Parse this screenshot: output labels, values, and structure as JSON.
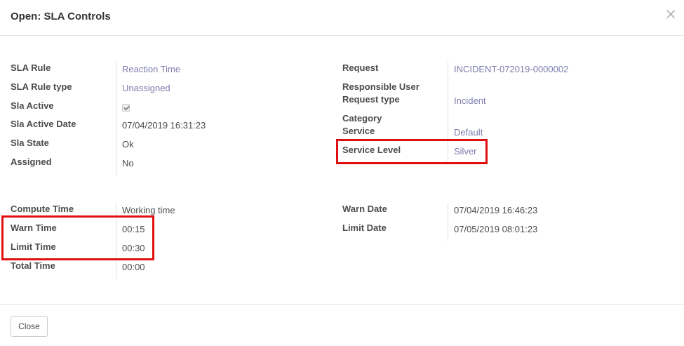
{
  "dialog": {
    "title": "Open: SLA Controls",
    "close_symbol": "×"
  },
  "left_group_1": [
    {
      "label": "SLA Rule",
      "value": "Reaction Time"
    },
    {
      "label": "SLA Rule type",
      "value": "Unassigned"
    },
    {
      "label": "Sla Active",
      "value_type": "checkbox",
      "checked": true
    },
    {
      "label": "Sla Active Date",
      "value": "07/04/2019 16:31:23"
    },
    {
      "label": "Sla State",
      "value": "Ok"
    },
    {
      "label": "Assigned",
      "value": "No"
    }
  ],
  "right_group_1": [
    {
      "label": "Request",
      "value": "INCIDENT-072019-0000002"
    },
    {
      "label": "Responsible User",
      "value": ""
    },
    {
      "label": "Request type",
      "value": "Incident"
    },
    {
      "label": "Category",
      "value": ""
    },
    {
      "label": "Service",
      "value": "Default"
    },
    {
      "label": "Service Level",
      "value": "Silver"
    }
  ],
  "left_group_2": [
    {
      "label": "Compute Time",
      "value": "Working time"
    },
    {
      "label": "Warn Time",
      "value": "00:15"
    },
    {
      "label": "Limit Time",
      "value": "00:30"
    },
    {
      "label": "Total Time",
      "value": "00:00"
    }
  ],
  "right_group_2": [
    {
      "label": "Warn Date",
      "value": "07/04/2019 16:46:23"
    },
    {
      "label": "Limit Date",
      "value": "07/05/2019 08:01:23"
    }
  ],
  "footer": {
    "close_label": "Close"
  },
  "colors": {
    "highlight": "#e01010",
    "link": "#7c7bad",
    "text": "#4c4c4c"
  }
}
